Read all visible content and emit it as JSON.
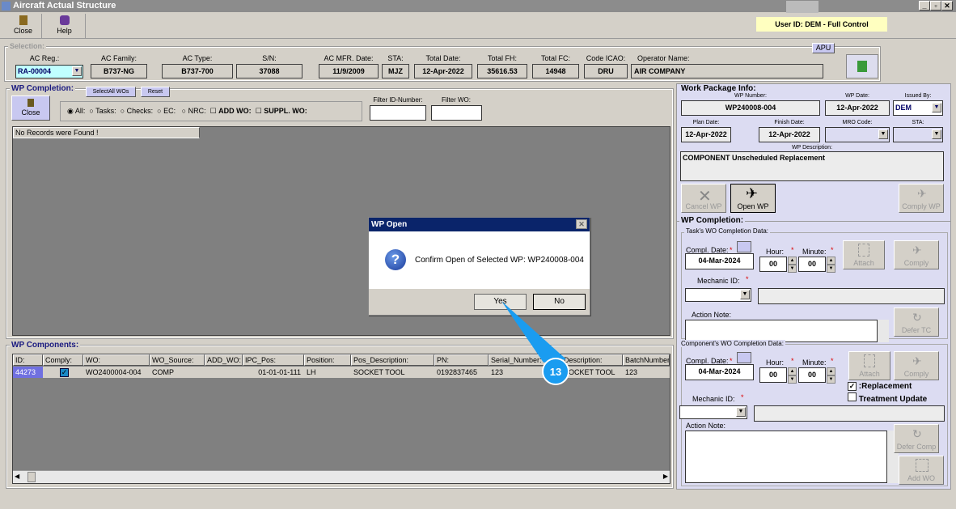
{
  "window": {
    "title": "Aircraft Actual Structure",
    "min": "_",
    "max": "▫",
    "close": "✕"
  },
  "toolbar": {
    "close": "Close",
    "help": "Help"
  },
  "user": "User ID: DEM - Full Control",
  "selection": {
    "label": "Selection:",
    "apu": "APU",
    "fields": [
      {
        "label": "AC Reg.:",
        "value": "RA-00004"
      },
      {
        "label": "AC Family:",
        "value": "B737-NG"
      },
      {
        "label": "AC Type:",
        "value": "B737-700"
      },
      {
        "label": "S/N:",
        "value": "37088"
      },
      {
        "label": "AC MFR. Date:",
        "value": "11/9/2009"
      },
      {
        "label": "STA:",
        "value": "MJZ"
      },
      {
        "label": "Total Date:",
        "value": "12-Apr-2022"
      },
      {
        "label": "Total FH:",
        "value": "35616.53"
      },
      {
        "label": "Total FC:",
        "value": "14948"
      },
      {
        "label": "Code ICAO:",
        "value": "DRU"
      },
      {
        "label": "Operator Name:",
        "value": "AIR COMPANY"
      }
    ]
  },
  "wp_completion": {
    "label": "WP Completion:",
    "select_all": "SelectAll WOs",
    "reset": "Reset",
    "close": "Close",
    "radios": [
      "All:",
      "Tasks:",
      "Checks:",
      "EC:",
      "NRC:"
    ],
    "add_wo": "ADD WO:",
    "suppl_wo": "SUPPL. WO:",
    "filter_id": "Filter ID-Number:",
    "filter_wo": "Filter WO:",
    "no_records": "No Records were Found !"
  },
  "components": {
    "label": "WP Components:",
    "columns": [
      "ID:",
      "Comply:",
      "WO:",
      "WO_Source:",
      "ADD_WO:",
      "IPC_Pos:",
      "Position:",
      "Pos_Description:",
      "PN:",
      "Serial_Number:",
      "Description:",
      "BatchNumber"
    ],
    "rows": [
      {
        "id": "44273",
        "comply": true,
        "wo": "WO2400004-004",
        "source": "COMP",
        "add_wo": "",
        "ipc": "01-01-01-111",
        "position": "LH",
        "pos_desc": "SOCKET TOOL",
        "pn": "0192837465",
        "serial": "123",
        "desc": "SOCKET TOOL",
        "batch": "123"
      }
    ]
  },
  "wp_info": {
    "label": "Work Package Info:",
    "wp_number_label": "WP Number:",
    "wp_number": "WP240008-004",
    "wp_date_label": "WP Date:",
    "wp_date": "12-Apr-2022",
    "issued_by_label": "Issued By:",
    "issued_by": "DEM",
    "plan_date_label": "Plan Date:",
    "plan_date": "12-Apr-2022",
    "finish_date_label": "Finish Date:",
    "finish_date": "12-Apr-2022",
    "mro_label": "MRO Code:",
    "sta_label": "STA:",
    "desc_label": "WP Description:",
    "desc": "COMPONENT Unscheduled Replacement",
    "cancel": "Cancel WP",
    "open": "Open WP",
    "comply": "Comply WP"
  },
  "right_completion": {
    "label": "WP Completion:",
    "task": {
      "label": "Task's WO Completion Data:",
      "date_label": "Compl. Date:",
      "date": "04-Mar-2024",
      "hour_label": "Hour:",
      "hour": "00",
      "minute_label": "Minute:",
      "minute": "00",
      "mechanic": "Mechanic ID:",
      "note": "Action Note:",
      "attach": "Attach",
      "comply": "Comply",
      "defer": "Defer TC"
    },
    "comp": {
      "label": "Component's WO Completion Data:",
      "date_label": "Compl. Date:",
      "date": "04-Mar-2024",
      "hour_label": "Hour:",
      "hour": "00",
      "minute_label": "Minute:",
      "minute": "00",
      "mechanic": "Mechanic ID:",
      "note": "Action Note:",
      "attach": "Attach",
      "comply": "Comply",
      "replacement": ":Replacement",
      "replacement_checked": true,
      "treatment": "Treatment Update",
      "treatment_checked": false,
      "defer": "Defer Comp",
      "add_wo": "Add WO"
    }
  },
  "dialog": {
    "title": "WP Open",
    "message": "Confirm Open of Selected WP: WP240008-004",
    "yes": "Yes",
    "no": "No",
    "close": "✕"
  },
  "callout": {
    "number": "13",
    "color": "#1a9cf0"
  }
}
